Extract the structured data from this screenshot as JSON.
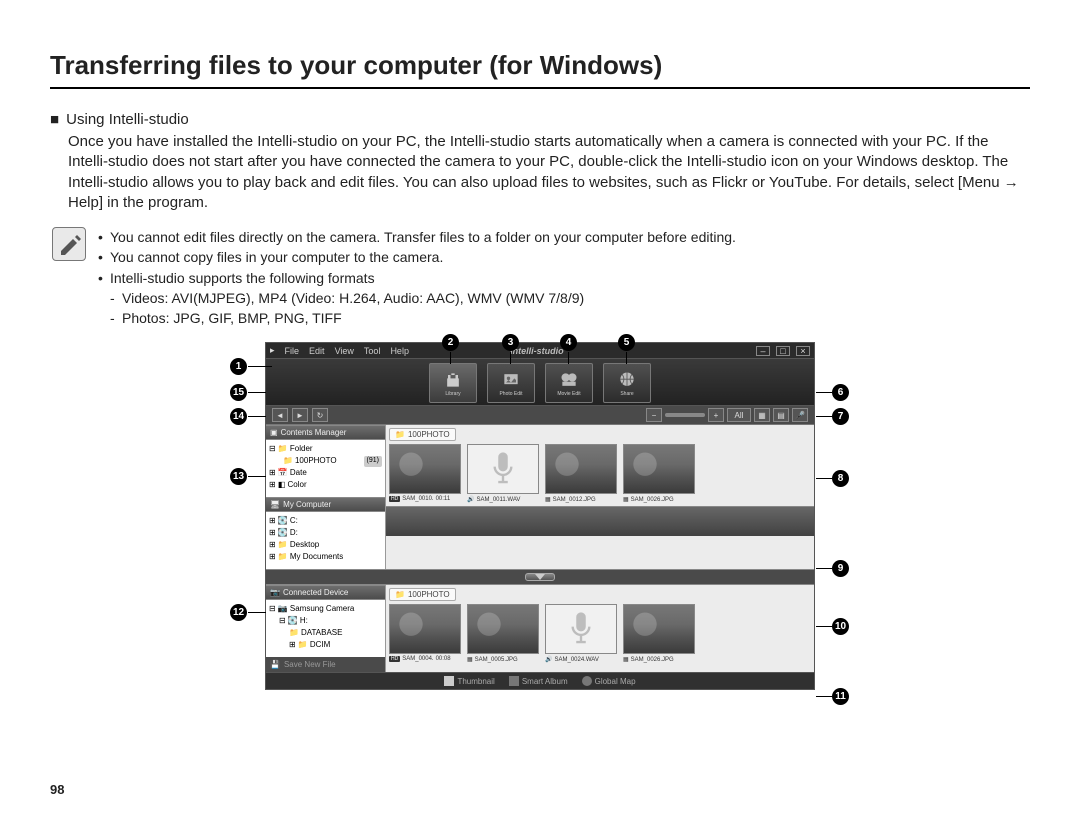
{
  "page": {
    "title": "Transferring files to your computer (for Windows)",
    "number": "98"
  },
  "section": {
    "subhead": "Using Intelli-studio",
    "paragraph": "Once you have installed the Intelli-studio on your PC, the Intelli-studio starts automatically when a camera is connected with your PC. If the Intelli-studio does not start after you have connected the camera to your PC, double-click the Intelli-studio icon on your Windows desktop. The Intelli-studio allows you to play back and edit files. You can also upload files to websites, such as Flickr or YouTube. For details, select [Menu → Help] in the program."
  },
  "notes": {
    "b1": "You cannot edit files directly on the camera. Transfer files to a folder on your computer before editing.",
    "b2": "You cannot copy files in your computer to the camera.",
    "b3": "Intelli-studio supports the following formats",
    "b3a": "Videos: AVI(MJPEG), MP4 (Video: H.264, Audio: AAC), WMV (WMV 7/8/9)",
    "b3b": "Photos: JPG, GIF, BMP, PNG, TIFF"
  },
  "app": {
    "brand": "Intelli-studio",
    "menu": {
      "file": "File",
      "edit": "Edit",
      "view": "View",
      "tool": "Tool",
      "help": "Help"
    },
    "tabs": {
      "library": "Library",
      "photoedit": "Photo Edit",
      "movieedit": "Movie Edit",
      "share": "Share"
    },
    "toolbar_right": {
      "all": "All"
    },
    "sidebar": {
      "contents_manager": "Contents Manager",
      "folder": "Folder",
      "folder_100photo": "100PHOTO",
      "folder_100photo_count": "(91)",
      "date": "Date",
      "color": "Color",
      "my_computer": "My Computer",
      "drive_c": "C:",
      "drive_d": "D:",
      "desktop": "Desktop",
      "my_documents": "My Documents",
      "connected_device": "Connected Device",
      "camera": "Samsung Camera",
      "drive_h": "H:",
      "database": "DATABASE",
      "dcim": "DCIM",
      "save_new": "Save New File"
    },
    "crumb": "100PHOTO",
    "thumbs_top": [
      {
        "hd": "HD",
        "name": "SAM_0010.",
        "time": "00:11"
      },
      {
        "name": "SAM_0011.WAV"
      },
      {
        "name": "SAM_0012.JPG"
      },
      {
        "name": "SAM_0026.JPG"
      }
    ],
    "thumbs_bottom": [
      {
        "hd": "HD",
        "name": "SAM_0004.",
        "time": "00:08"
      },
      {
        "name": "SAM_0005.JPG"
      },
      {
        "name": "SAM_0024.WAV"
      },
      {
        "name": "SAM_0026.JPG"
      }
    ],
    "bottombar": {
      "thumbnail": "Thumbnail",
      "smart": "Smart Album",
      "global": "Global Map"
    }
  },
  "callouts": {
    "1": "1",
    "2": "2",
    "3": "3",
    "4": "4",
    "5": "5",
    "6": "6",
    "7": "7",
    "8": "8",
    "9": "9",
    "10": "10",
    "11": "11",
    "12": "12",
    "13": "13",
    "14": "14",
    "15": "15"
  }
}
